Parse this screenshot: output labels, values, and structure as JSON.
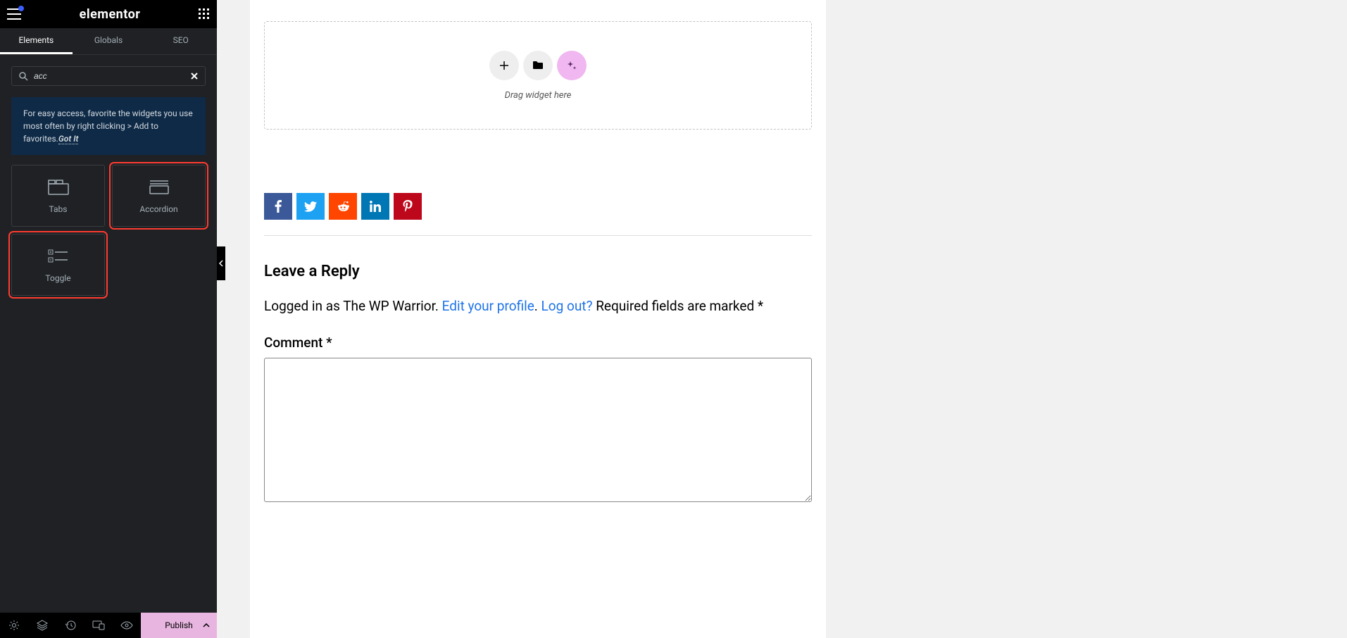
{
  "header": {
    "logo": "elementor"
  },
  "tabs": [
    "Elements",
    "Globals",
    "SEO"
  ],
  "search": {
    "value": "acc"
  },
  "tip": {
    "text": "For easy access, favorite the widgets you use most often by right clicking > Add to favorites.",
    "gotit": "Got It"
  },
  "widgets": [
    {
      "label": "Tabs",
      "icon": "tabs",
      "highlight": false
    },
    {
      "label": "Accordion",
      "icon": "accordion",
      "highlight": true
    },
    {
      "label": "Toggle",
      "icon": "toggle",
      "highlight": true
    }
  ],
  "footer": {
    "publish": "Publish"
  },
  "dropzone": {
    "text": "Drag widget here"
  },
  "reply": {
    "heading": "Leave a Reply",
    "logged_pre": "Logged in as The WP Warrior. ",
    "edit": "Edit your profile",
    "sep1": ". ",
    "logout": "Log out?",
    "post": " Required fields are marked *",
    "comment_label": "Comment *"
  }
}
